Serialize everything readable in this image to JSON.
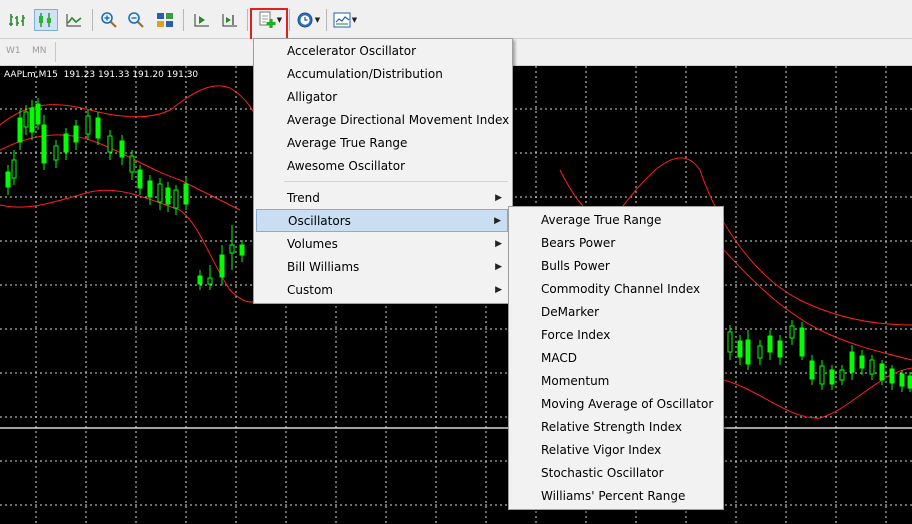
{
  "toolbar": {
    "icons": [
      "bar-chart-icon",
      "candlestick-chart-icon",
      "line-chart-icon",
      "zoom-in-icon",
      "zoom-out-icon",
      "tile-windows-icon",
      "chart-shift-icon",
      "auto-scroll-icon",
      "indicators-icon",
      "periods-icon",
      "templates-icon"
    ]
  },
  "timeframes": [
    "W1",
    "MN"
  ],
  "chart": {
    "symbol": "AAPLm,M15",
    "ohlc": "191.23 191.33 191.20 191.30"
  },
  "indicator_menu": {
    "items": [
      "Accelerator Oscillator",
      "Accumulation/Distribution",
      "Alligator",
      "Average Directional Movement Index",
      "Average True Range",
      "Awesome Oscillator"
    ],
    "submenus": [
      "Trend",
      "Oscillators",
      "Volumes",
      "Bill Williams",
      "Custom"
    ],
    "highlighted": "Oscillators"
  },
  "oscillators_menu": {
    "items": [
      "Average True Range",
      "Bears Power",
      "Bulls Power",
      "Commodity Channel Index",
      "DeMarker",
      "Force Index",
      "MACD",
      "Momentum",
      "Moving Average of Oscillator",
      "Relative Strength Index",
      "Relative Vigor Index",
      "Stochastic Oscillator",
      "Williams' Percent Range"
    ]
  },
  "colors": {
    "chart_bg": "#000000",
    "bull_candle": "#00ff00",
    "bands": "#ff2020",
    "grid": "#ffffff",
    "highlight": "#c9def0"
  }
}
